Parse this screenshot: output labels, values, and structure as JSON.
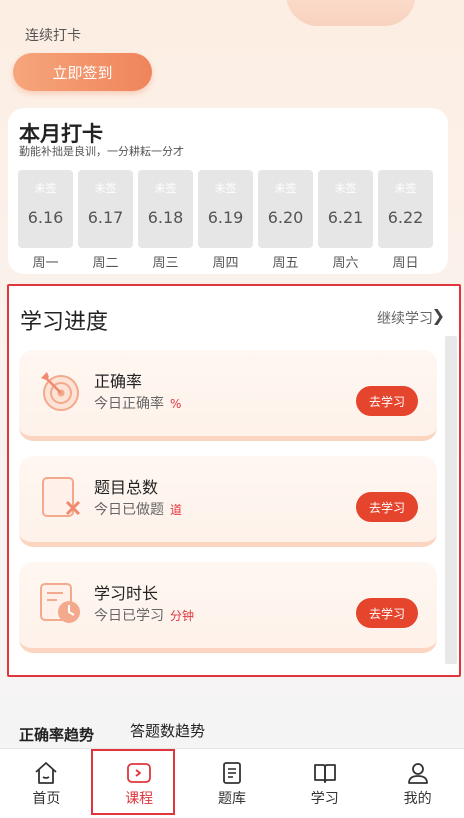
{
  "header": {
    "streak_label": "连续打卡",
    "checkin_button": "立即签到"
  },
  "month": {
    "title": "本月打卡",
    "subtitle": "勤能补拙是良训，一分耕耘一分才",
    "days": [
      {
        "status": "未签",
        "date": "6.16",
        "weekday": "周一"
      },
      {
        "status": "未签",
        "date": "6.17",
        "weekday": "周二"
      },
      {
        "status": "未签",
        "date": "6.18",
        "weekday": "周三"
      },
      {
        "status": "未签",
        "date": "6.19",
        "weekday": "周四"
      },
      {
        "status": "未签",
        "date": "6.20",
        "weekday": "周五"
      },
      {
        "status": "未签",
        "date": "6.21",
        "weekday": "周六"
      },
      {
        "status": "未签",
        "date": "6.22",
        "weekday": "周日"
      }
    ]
  },
  "progress": {
    "title": "学习进度",
    "continue_label": "继续学习",
    "cards": [
      {
        "title": "正确率",
        "subtitle": "今日正确率",
        "unit": "%",
        "button": "去学习",
        "icon": "target-icon"
      },
      {
        "title": "题目总数",
        "subtitle": "今日已做题",
        "unit": "道",
        "button": "去学习",
        "icon": "document-x-icon"
      },
      {
        "title": "学习时长",
        "subtitle": "今日已学习",
        "unit": "分钟",
        "button": "去学习",
        "icon": "clock-document-icon"
      }
    ]
  },
  "trend": {
    "tabs": [
      "正确率趋势",
      "答题数趋势"
    ]
  },
  "tabbar": {
    "items": [
      {
        "label": "首页",
        "icon": "home-icon"
      },
      {
        "label": "课程",
        "icon": "play-icon"
      },
      {
        "label": "题库",
        "icon": "question-bank-icon"
      },
      {
        "label": "学习",
        "icon": "book-icon"
      },
      {
        "label": "我的",
        "icon": "user-icon"
      }
    ],
    "active_index": 1
  },
  "colors": {
    "accent": "#e5452d",
    "highlight_border": "#e0353c",
    "checkin_gradient_start": "#f6a57c",
    "checkin_gradient_end": "#f0845a"
  }
}
